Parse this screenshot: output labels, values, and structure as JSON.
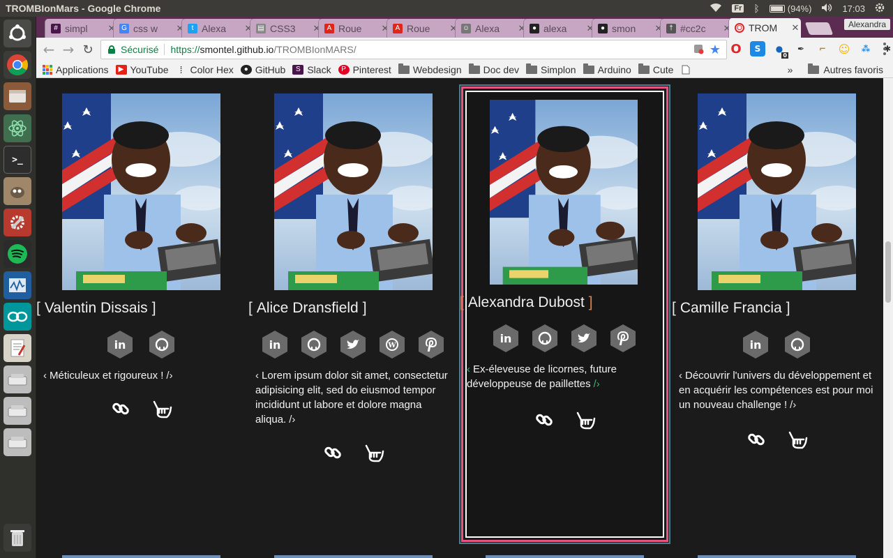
{
  "os_panel": {
    "window_title": "TROMBIonMars - Google Chrome",
    "keyboard_layout": "Fr",
    "battery": "(94%)",
    "clock": "17:03"
  },
  "launcher": {
    "items": [
      "ubuntu-icon",
      "chrome-icon",
      "files-icon",
      "atom-icon",
      "terminal-icon",
      "gimp-icon",
      "settings-icon",
      "spotify-icon",
      "monitor-icon",
      "arduino-icon",
      "text-editor-icon",
      "drive-icon",
      "drive-icon",
      "drive-icon",
      "trash-icon"
    ]
  },
  "tabs": [
    {
      "label": "simpl",
      "favicon": "slack-icon",
      "color": "#4a154b"
    },
    {
      "label": "css w",
      "favicon": "google-icon",
      "color": "#4285f4"
    },
    {
      "label": "Alexa",
      "favicon": "twitter-icon",
      "color": "#1da1f2"
    },
    {
      "label": "CSS3",
      "favicon": "page-icon",
      "color": "#888888"
    },
    {
      "label": "Roue",
      "favicon": "adobe-icon",
      "color": "#e1251b"
    },
    {
      "label": "Roue",
      "favicon": "adobe-icon",
      "color": "#e1251b"
    },
    {
      "label": "Alexa",
      "favicon": "alien-icon",
      "color": "#777777"
    },
    {
      "label": "alexa",
      "favicon": "github-icon",
      "color": "#222222"
    },
    {
      "label": "smon",
      "favicon": "github-icon",
      "color": "#222222"
    },
    {
      "label": "#cc2c",
      "favicon": "pin-icon",
      "color": "#555555"
    },
    {
      "label": "TROM",
      "favicon": "opera-icon",
      "color": "#e0262c",
      "active": true
    }
  ],
  "profile_name": "Alexandra",
  "omnibox": {
    "secure_label": "Sécurisé",
    "url_proto": "https://",
    "url_host": "smontel.github.io",
    "url_path": "/TROMBIonMARS/"
  },
  "bookmarks": [
    {
      "label": "Applications",
      "icon": "apps-icon"
    },
    {
      "label": "YouTube",
      "icon": "youtube-icon"
    },
    {
      "label": "Color Hex",
      "icon": "color-hex-icon"
    },
    {
      "label": "GitHub",
      "icon": "github-icon"
    },
    {
      "label": "Slack",
      "icon": "slack-icon"
    },
    {
      "label": "Pinterest",
      "icon": "pinterest-icon"
    },
    {
      "label": "Webdesign",
      "icon": "folder-icon"
    },
    {
      "label": "Doc dev",
      "icon": "folder-icon"
    },
    {
      "label": "Simplon",
      "icon": "folder-icon"
    },
    {
      "label": "Arduino",
      "icon": "folder-icon"
    },
    {
      "label": "Cute",
      "icon": "folder-icon"
    }
  ],
  "bookmarks_more": "»",
  "bookmarks_other": "Autres favoris",
  "cards": [
    {
      "name": "Valentin Dissais",
      "bracket_open": "[",
      "bracket_close": "]",
      "socials": [
        "linkedin-icon",
        "github-icon"
      ],
      "quote": "Méticuleux et rigoureux !",
      "quote_open": "‹",
      "quote_close": "/›"
    },
    {
      "name": "Alice Dransfield",
      "bracket_open": "[",
      "bracket_close": "]",
      "socials": [
        "linkedin-icon",
        "github-icon",
        "twitter-icon",
        "wordpress-icon",
        "pinterest-icon"
      ],
      "quote": "Lorem ipsum dolor sit amet, consectetur adipisicing elit, sed do eiusmod tempor incididunt ut labore et dolore magna aliqua.",
      "quote_open": "‹",
      "quote_close": "/›"
    },
    {
      "name": "Alexandra Dubost",
      "bracket_open": "[",
      "bracket_close": "]",
      "socials": [
        "linkedin-icon",
        "github-icon",
        "twitter-icon",
        "pinterest-icon"
      ],
      "quote": "Ex-éleveuse de licornes, future développeuse de paillettes",
      "quote_open": "‹",
      "quote_close": "/›",
      "accent": "#e67e45"
    },
    {
      "name": "Camille Francia",
      "bracket_open": "[",
      "bracket_close": "]",
      "socials": [
        "linkedin-icon",
        "github-icon"
      ],
      "quote": "Découvrir l'univers du développement et en acquérir les compétences est pour moi un nouveau challenge !",
      "quote_open": "‹",
      "quote_close": "/›"
    }
  ]
}
